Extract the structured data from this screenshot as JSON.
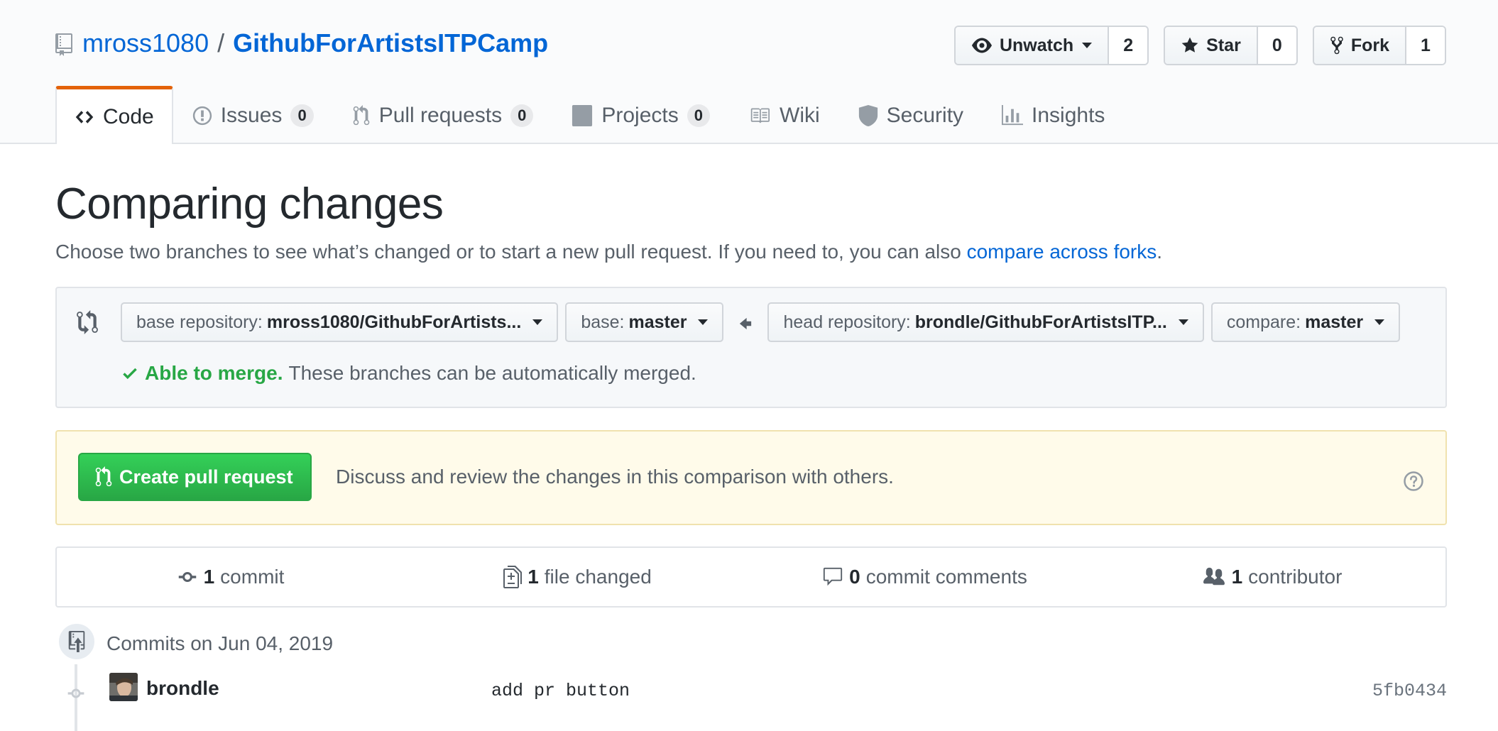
{
  "repo": {
    "owner": "mross1080",
    "separator": "/",
    "name": "GithubForArtistsITPCamp"
  },
  "actions": {
    "watch": {
      "label": "Unwatch",
      "count": "2",
      "icon": "eye-icon"
    },
    "star": {
      "label": "Star",
      "count": "0",
      "icon": "star-icon"
    },
    "fork": {
      "label": "Fork",
      "count": "1",
      "icon": "repo-forked-icon"
    }
  },
  "tabs": [
    {
      "label": "Code",
      "icon": "code-icon",
      "selected": true
    },
    {
      "label": "Issues",
      "count": "0",
      "icon": "issue-opened-icon"
    },
    {
      "label": "Pull requests",
      "count": "0",
      "icon": "git-pull-request-icon"
    },
    {
      "label": "Projects",
      "count": "0",
      "icon": "project-icon"
    },
    {
      "label": "Wiki",
      "icon": "book-icon"
    },
    {
      "label": "Security",
      "icon": "shield-icon"
    },
    {
      "label": "Insights",
      "icon": "graph-icon"
    }
  ],
  "page": {
    "title": "Comparing changes",
    "description": "Choose two branches to see what’s changed or to start a new pull request. If you need to, you can also ",
    "description_link": "compare across forks",
    "description_end": "."
  },
  "range": {
    "base_repo_label": "base repository:",
    "base_repo_value": "mross1080/GithubForArtists...",
    "base_label": "base:",
    "base_value": "master",
    "head_repo_label": "head repository:",
    "head_repo_value": "brondle/GithubForArtistsITP...",
    "compare_label": "compare:",
    "compare_value": "master",
    "merge_ok": "Able to merge.",
    "merge_text": "These branches can be automatically merged."
  },
  "compare_pr": {
    "button_label": "Create pull request",
    "description": "Discuss and review the changes in this comparison with others."
  },
  "summary": {
    "commits": {
      "num": "1",
      "label": "commit"
    },
    "files": {
      "num": "1",
      "label": "file changed"
    },
    "comments": {
      "num": "0",
      "label": "commit comments"
    },
    "contributors": {
      "num": "1",
      "label": "contributor"
    }
  },
  "commits": {
    "group_title": "Commits on Jun 04, 2019",
    "items": [
      {
        "author": "brondle",
        "message": "add pr button",
        "sha": "5fb0434"
      }
    ]
  },
  "colors": {
    "link": "#0366d6",
    "success": "#28a745",
    "tab_accent": "#e36209",
    "muted": "#586069"
  }
}
